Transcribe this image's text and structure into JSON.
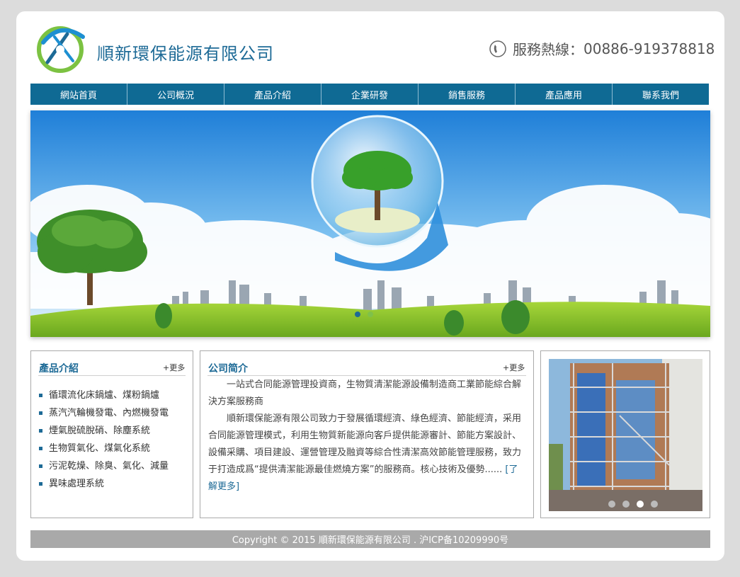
{
  "header": {
    "company_name": "順新環保能源有限公司",
    "hotline_label": "服務熱線：",
    "hotline_number": "00886-919378818"
  },
  "nav": {
    "items": [
      "網站首頁",
      "公司概況",
      "產品介紹",
      "企業研發",
      "銷售服務",
      "產品應用",
      "聯系我們"
    ]
  },
  "banner": {
    "slide_count": 2,
    "active_slide": 1
  },
  "products": {
    "title": "產品介紹",
    "more": "+更多",
    "items": [
      "循環流化床鍋爐、煤粉鍋爐",
      "蒸汽汽輪機發電、內燃機發電",
      "煙氣脫硫脫硝、除塵系統",
      "生物質氣化、煤氣化系統",
      "污泥乾燥、除臭、氣化、減量",
      "異味處理系統"
    ]
  },
  "about": {
    "title": "公司简介",
    "more": "+更多",
    "para1": "一站式合同能源管理投資商，生物質清潔能源設備制造商工業節能綜合解決方案服務商",
    "para2": "順新環保能源有限公司致力于發展循環經濟、綠色經濟、節能經濟，采用合同能源管理模式，利用生物質新能源向客戶提供能源審計、節能方案設計、設備采購、項目建設、運營管理及融資等綜合性清潔高效節能管理服務，致力于打造成爲“提供清潔能源最佳燃燒方案”的服務商。核心技術及優勢......",
    "read_more": "[了解更多]"
  },
  "photo": {
    "slide_count": 4,
    "active_slide": 3
  },
  "footer": {
    "text": "Copyright © 2015 順新環保能源有限公司 . 沪ICP备10209990号"
  },
  "colors": {
    "brand_blue": "#1d6a96",
    "nav_bg": "#0f6a94",
    "footer_bg": "#a9a9a9",
    "page_bg": "#dcdcdc"
  }
}
